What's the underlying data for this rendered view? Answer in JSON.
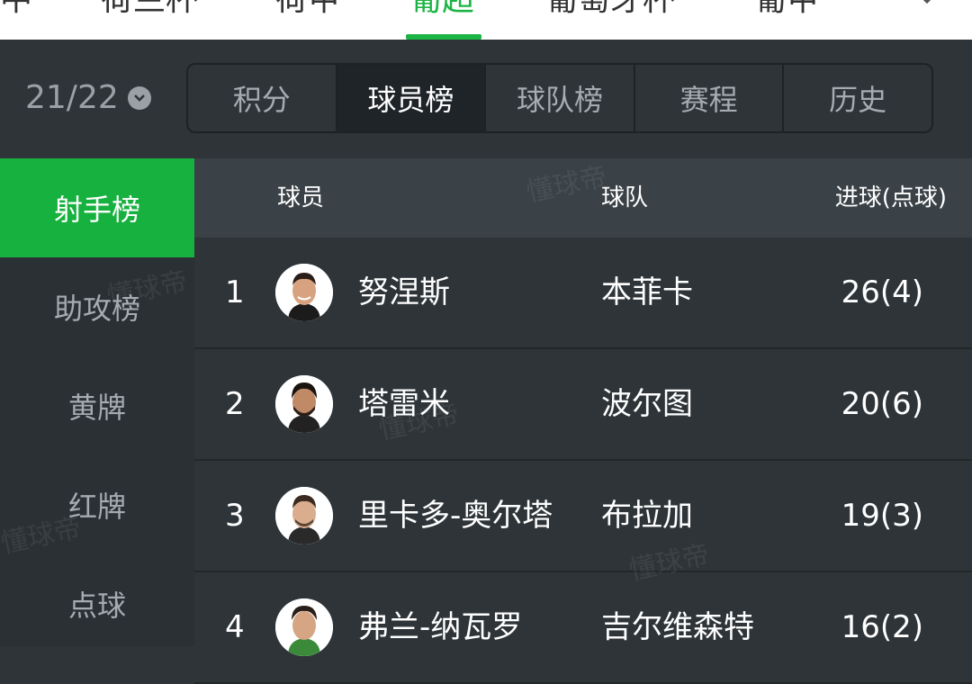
{
  "top_nav": {
    "items": [
      "中",
      "荷兰杯",
      "荷甲",
      "葡超",
      "葡萄牙杯",
      "葡甲"
    ],
    "active_index": 3
  },
  "season": {
    "label": "21/22"
  },
  "tabs": [
    {
      "label": "积分"
    },
    {
      "label": "球员榜"
    },
    {
      "label": "球队榜"
    },
    {
      "label": "赛程"
    },
    {
      "label": "历史"
    }
  ],
  "sidebar": {
    "items": [
      {
        "label": "射手榜"
      },
      {
        "label": "助攻榜"
      },
      {
        "label": "黄牌"
      },
      {
        "label": "红牌"
      },
      {
        "label": "点球"
      }
    ]
  },
  "table": {
    "headers": {
      "player": "球员",
      "team": "球队",
      "goals": "进球(点球)"
    },
    "rows": [
      {
        "rank": "1",
        "player": "努涅斯",
        "team": "本菲卡",
        "goals": "26(4)"
      },
      {
        "rank": "2",
        "player": "塔雷米",
        "team": "波尔图",
        "goals": "20(6)"
      },
      {
        "rank": "3",
        "player": "里卡多-奥尔塔",
        "team": "布拉加",
        "goals": "19(3)"
      },
      {
        "rank": "4",
        "player": "弗兰-纳瓦罗",
        "team": "吉尔维森特",
        "goals": "16(2)"
      }
    ]
  },
  "watermark": "懂球帝",
  "colors": {
    "accent": "#1db446",
    "background": "#2e3438",
    "header": "#3a4247"
  }
}
